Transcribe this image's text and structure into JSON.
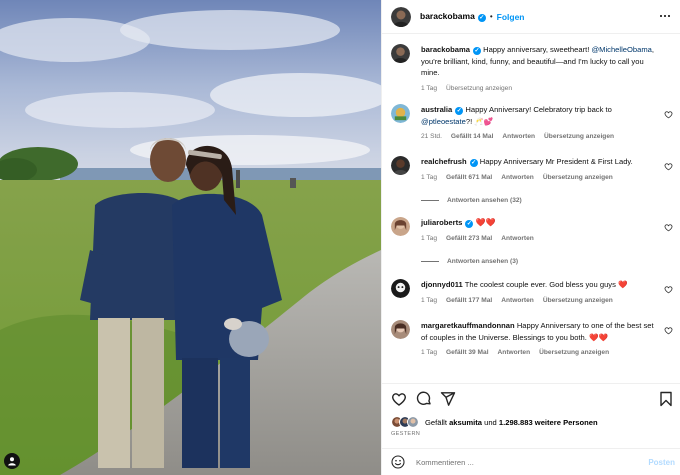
{
  "header": {
    "username": "barackobama",
    "follow_label": "Folgen"
  },
  "caption": {
    "username": "barackobama",
    "text_before": "Happy anniversary, sweetheart! ",
    "mention": "@MichelleObama",
    "text_after": ", you're brilliant, kind, funny, and beautiful—and I'm lucky to call you mine.",
    "time": "1 Tag",
    "translate_label": "Übersetzung anzeigen"
  },
  "comments": [
    {
      "username": "australia",
      "verified": true,
      "text_before": "Happy Anniversary! Celebratory trip back to ",
      "mention": "@ptleoestate",
      "text_after": "?! 🥂💕",
      "time": "21 Std.",
      "likes": "Gefällt 14 Mal",
      "reply_label": "Antworten",
      "translate_label": "Übersetzung anzeigen"
    },
    {
      "username": "realchefrush",
      "verified": true,
      "text": "Happy Anniversary Mr President & First Lady.",
      "time": "1 Tag",
      "likes": "Gefällt 671 Mal",
      "reply_label": "Antworten",
      "translate_label": "Übersetzung anzeigen",
      "view_replies": "Antworten ansehen (32)"
    },
    {
      "username": "juliaroberts",
      "verified": true,
      "text": "❤️❤️",
      "time": "1 Tag",
      "likes": "Gefällt 273 Mal",
      "reply_label": "Antworten",
      "view_replies": "Antworten ansehen (3)"
    },
    {
      "username": "djonnyd011",
      "verified": false,
      "text": "The coolest couple ever. God bless you guys ❤️",
      "time": "1 Tag",
      "likes": "Gefällt 177 Mal",
      "reply_label": "Antworten",
      "translate_label": "Übersetzung anzeigen"
    },
    {
      "username": "margaretkauffmandonnan",
      "verified": false,
      "text": "Happy Anniversary to one of the best set of couples in the Universe. Blessings to you both. ❤️❤️",
      "time": "1 Tag",
      "likes": "Gefällt 39 Mal",
      "reply_label": "Antworten",
      "translate_label": "Übersetzung anzeigen"
    }
  ],
  "likes_summary": {
    "prefix": "Gefällt ",
    "user": "aksumita",
    "middle": " und ",
    "count": "1.298.883 weitere Personen"
  },
  "date": "GESTERN",
  "composer": {
    "placeholder": "Kommentieren ...",
    "post_label": "Posten"
  },
  "icons": {
    "like": "heart-icon",
    "comment": "comment-icon",
    "share": "paper-plane-icon",
    "save": "bookmark-icon",
    "emoji": "smiley-icon",
    "more": "more-horizontal-icon",
    "tag": "user-tag-icon"
  },
  "colors": {
    "accent": "#0095f6",
    "mention": "#00376b",
    "muted": "#737373",
    "heart": "#ed4956"
  }
}
